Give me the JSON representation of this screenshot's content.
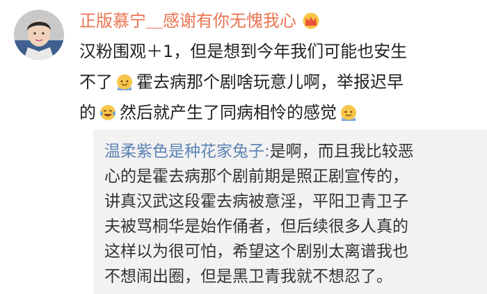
{
  "post": {
    "username": "正版慕宁＿感谢有你无愧我心",
    "badge_icon": "crown-icon",
    "comment_lines": {
      "l1": "汉粉围观＋1，但是想到今年我们可能也安生",
      "l2a": "不了",
      "l2b": "霍去病那个剧啥玩意儿啊，举报迟早",
      "l3a": "的",
      "l3b": "然后就产生了同病相怜的感觉"
    },
    "emojis": [
      "sweat-smile-icon",
      "laugh-cry-icon",
      "sweat-smile-icon"
    ]
  },
  "reply": {
    "author": "温柔紫色是种花家兔子:",
    "lines": {
      "l1": "是啊，而且我比较恶",
      "l2": "心的是霍去病那个剧前期是照正剧宣传的，",
      "l3": "讲真汉武这段霍去病被意淫，平阳卫青卫子",
      "l4": "夫被骂桐华是始作俑者，但后续很多人真的",
      "l5": "这样以为很可怕，希望这个剧别太离谱我也",
      "l6": "不想闹出圈，但是黑卫青我就不想忍了。"
    }
  },
  "colors": {
    "username": "#eb7350",
    "mention": "#5d83b5",
    "text": "#222222",
    "quote_bg": "#f2f2f2"
  }
}
